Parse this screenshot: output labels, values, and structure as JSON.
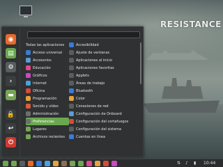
{
  "wallpaper": {
    "title": "RESISTANCE"
  },
  "menu": {
    "search": {
      "value": ""
    },
    "favorites": [
      {
        "name": "firefox-icon",
        "color": "#e66a2c"
      },
      {
        "name": "software-manager-icon",
        "color": "#6aa84f"
      },
      {
        "name": "system-settings-icon",
        "color": "#5a5d5e"
      },
      {
        "name": "terminal-icon",
        "color": "#3b3e3f"
      },
      {
        "name": "files-icon",
        "color": "#76a654"
      },
      {
        "name": "lock-screen-icon",
        "color": "#3b3e3f"
      },
      {
        "name": "logout-icon",
        "color": "#3b3e3f"
      },
      {
        "name": "shutdown-icon",
        "color": "#d03a2f"
      }
    ],
    "categories": [
      {
        "label": "Todas las aplicaciones",
        "color": ""
      },
      {
        "label": "Acceso universal",
        "color": "#3a7bd5"
      },
      {
        "label": "Accesorios",
        "color": "#5c9bd6"
      },
      {
        "label": "Educación",
        "color": "#e04a8a"
      },
      {
        "label": "Gráficos",
        "color": "#c94bc4"
      },
      {
        "label": "Internet",
        "color": "#4aa3df"
      },
      {
        "label": "Oficina",
        "color": "#d84a3a"
      },
      {
        "label": "Programación",
        "color": "#e6a23c"
      },
      {
        "label": "Sonido y vídeo",
        "color": "#e05a3a"
      },
      {
        "label": "Administración",
        "color": "#6b6f70"
      },
      {
        "label": "Preferencias",
        "color": "#6b6f70"
      },
      {
        "label": "Lugares",
        "color": "#76a654"
      },
      {
        "label": "Archivos recientes",
        "color": "#76a654"
      }
    ],
    "apps": [
      {
        "label": "Accesibilidad",
        "color": "#3a7bd5"
      },
      {
        "label": "Ajuste de ventanas",
        "color": "#5a5d5e"
      },
      {
        "label": "Aplicaciones al inicio",
        "color": "#5a5d5e"
      },
      {
        "label": "Aplicaciones favoritas",
        "color": "#5a5d5e"
      },
      {
        "label": "Applets",
        "color": "#5a5d5e"
      },
      {
        "label": "Áreas de trabajo",
        "color": "#5a5d5e"
      },
      {
        "label": "Bluetooth",
        "color": "#3a7bd5"
      },
      {
        "label": "Color",
        "color": "#e6a23c"
      },
      {
        "label": "Conexiones de red",
        "color": "#5a5d5e"
      },
      {
        "label": "Configuración de Onboard",
        "color": "#5c9bd6"
      },
      {
        "label": "Configuración del cortafuegos",
        "color": "#d84a3a"
      },
      {
        "label": "Configuración del sistema",
        "color": "#5a5d5e"
      },
      {
        "label": "Cuentas en línea",
        "color": "#3a7bd5"
      }
    ]
  },
  "taskbar": {
    "apps": [
      {
        "name": "files-taskbar-icon",
        "color": "#76a654"
      },
      {
        "name": "terminal-taskbar-icon",
        "color": "#5a5d5e"
      },
      {
        "name": "firefox-taskbar-icon",
        "color": "#e66a2c"
      },
      {
        "name": "thunderbird-taskbar-icon",
        "color": "#3a7bd5"
      },
      {
        "name": "chromium-taskbar-icon",
        "color": "#4aa3df"
      },
      {
        "name": "vlc-taskbar-icon",
        "color": "#e6a23c"
      },
      {
        "name": "gimp-taskbar-icon",
        "color": "#8a6f4e"
      },
      {
        "name": "libreoffice-taskbar-icon",
        "color": "#76a654"
      },
      {
        "name": "software-manager-taskbar-icon",
        "color": "#6aa84f"
      },
      {
        "name": "hexchat-taskbar-icon",
        "color": "#e04a8a"
      },
      {
        "name": "rhythmbox-taskbar-icon",
        "color": "#e6a23c"
      },
      {
        "name": "transmission-taskbar-icon",
        "color": "#d84a3a"
      },
      {
        "name": "pix-taskbar-icon",
        "color": "#c94bc4"
      }
    ],
    "clock": "10:44"
  }
}
